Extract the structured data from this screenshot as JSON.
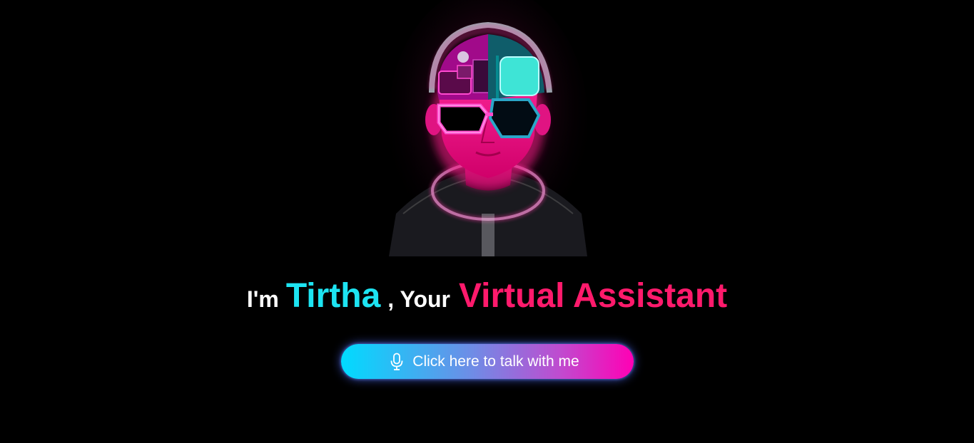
{
  "headline": {
    "prefix": "I'm",
    "name": "Tirtha",
    "separator": ", Your",
    "role": "Virtual Assistant"
  },
  "talk_button": {
    "label": "Click here to talk with me",
    "icon": "microphone-icon"
  },
  "avatar": {
    "icon": "cyberpunk-avatar"
  },
  "colors": {
    "background": "#000000",
    "name": "#1de4f2",
    "role": "#ff1a6c",
    "button_start": "#00dbff",
    "button_end": "#ff00b4"
  }
}
